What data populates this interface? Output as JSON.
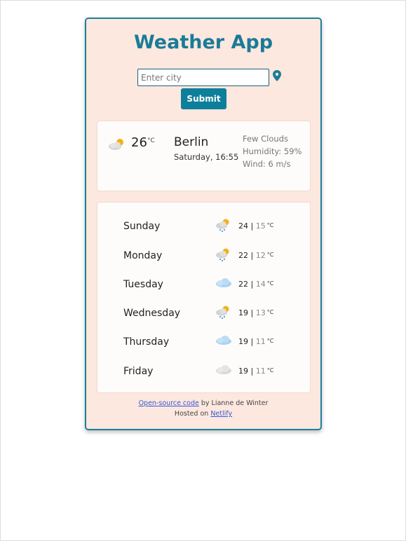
{
  "app": {
    "title": "Weather App"
  },
  "search": {
    "placeholder": "Enter city",
    "value": "",
    "submit_label": "Submit"
  },
  "current": {
    "temperature": "26",
    "unit": "°C",
    "icon": "few-clouds-icon",
    "city": "Berlin",
    "datetime": "Saturday, 16:55",
    "description": "Few Clouds",
    "humidity": "Humidity: 59%",
    "wind": "Wind: 6 m/s"
  },
  "forecast": [
    {
      "day": "Sunday",
      "high": "24",
      "low": "15",
      "unit": "°C",
      "icon": "sun-cloud-rain-icon"
    },
    {
      "day": "Monday",
      "high": "22",
      "low": "12",
      "unit": "°C",
      "icon": "sun-cloud-rain-icon"
    },
    {
      "day": "Tuesday",
      "high": "22",
      "low": "14",
      "unit": "°C",
      "icon": "cloud-icon"
    },
    {
      "day": "Wednesday",
      "high": "19",
      "low": "13",
      "unit": "°C",
      "icon": "sun-cloud-rain-icon"
    },
    {
      "day": "Thursday",
      "high": "19",
      "low": "11",
      "unit": "°C",
      "icon": "cloud-icon"
    },
    {
      "day": "Friday",
      "high": "19",
      "low": "11",
      "unit": "°C",
      "icon": "grey-cloud-icon"
    }
  ],
  "footer": {
    "source_link": "Open-source code",
    "author_text": " by Lianne de Winter",
    "hosted_text": "Hosted on ",
    "host_link": "Netlify"
  },
  "colors": {
    "accent": "#1b7b97",
    "card_bg": "#fde8df",
    "button_bg": "#0e7f9b",
    "link": "#3a56d4"
  }
}
